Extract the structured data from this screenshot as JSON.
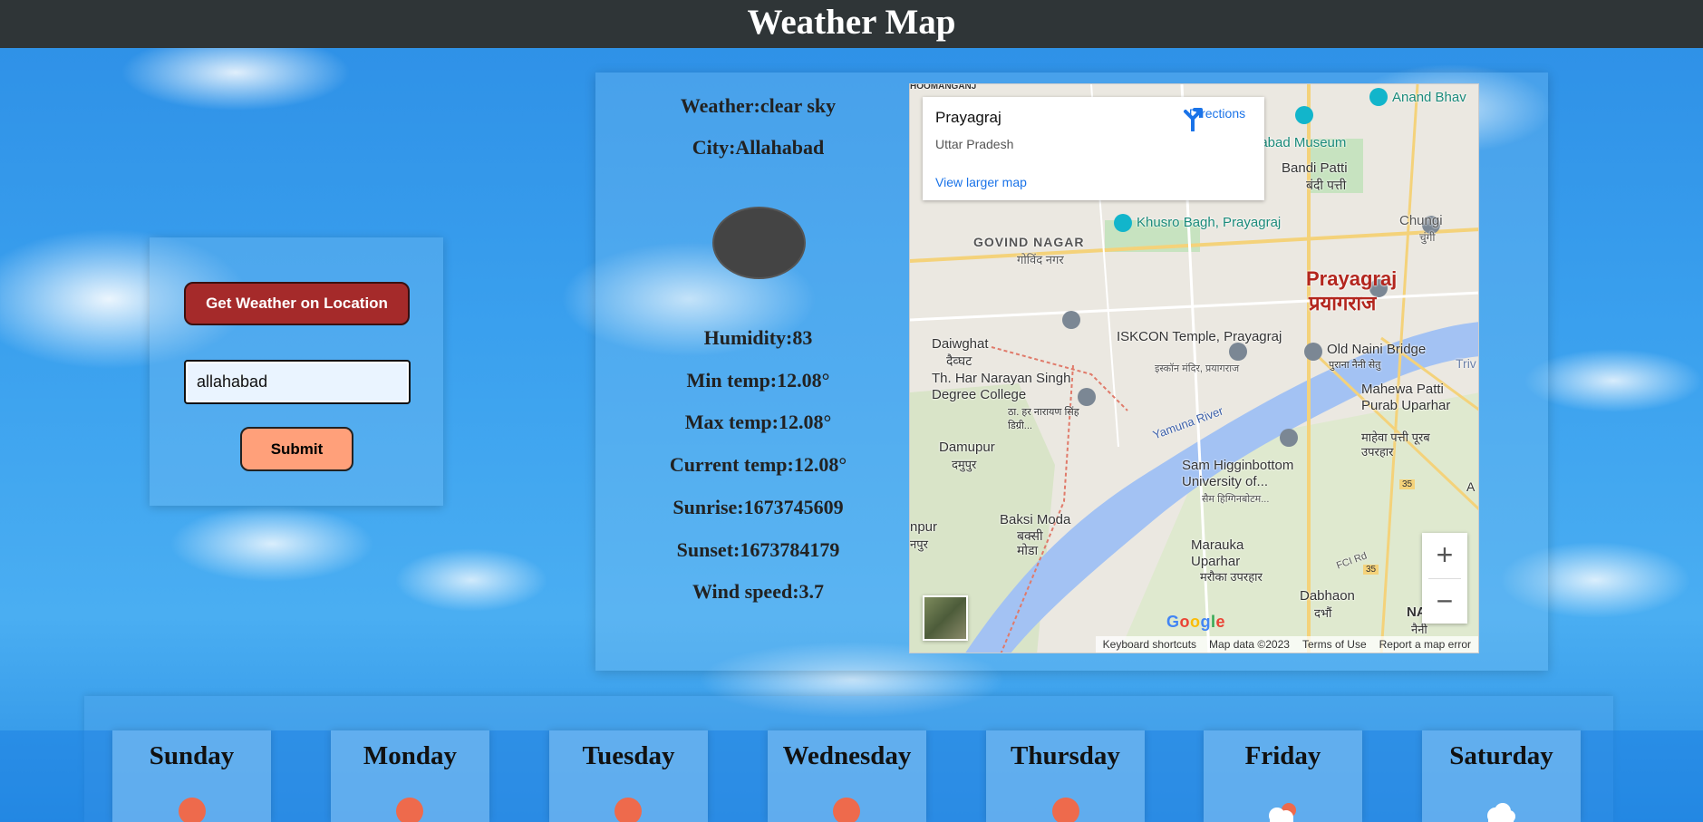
{
  "header": {
    "title": "Weather Map"
  },
  "controls": {
    "geo_button_label": "Get Weather on Location",
    "city_value": "allahabad",
    "submit_label": "Submit"
  },
  "weather": {
    "condition": "Weather:clear sky",
    "city": "City:Allahabad",
    "icon": "weather-icon",
    "humidity": "Humidity:83",
    "min_temp": "Min temp:12.08°",
    "max_temp": "Max temp:12.08°",
    "current_temp": "Current temp:12.08°",
    "sunrise": "Sunrise:1673745609",
    "sunset": "Sunset:1673784179",
    "wind_speed": "Wind speed:3.7"
  },
  "map": {
    "place_name": "Prayagraj",
    "region": "Uttar Pradesh",
    "directions_label": "Directions",
    "larger_map_label": "View larger map",
    "labels": {
      "city_en": "Prayagraj",
      "city_hi": "प्रयागराज",
      "govind_nagar": "GOVIND NAGAR",
      "govind_nagar_hi": "गोविंद नगर",
      "khusro": "Khusro Bagh, Prayagraj",
      "museum": "habad Museum",
      "anand": "Anand Bhav",
      "bandi_patti": "Bandi Patti",
      "bandi_patti_hi": "बंदी पत्ती",
      "chungi": "Chungi",
      "chungi_hi": "चुंगी",
      "daiwghat": "Daiwghat",
      "daiwghat_hi": "दैव्घट",
      "iskcon": "ISKCON Temple, Prayagraj",
      "iskcon_hi": "इस्कॉन मंदिर, प्रयागराज",
      "old_naini": "Old Naini Bridge",
      "old_naini_hi": "पुराना नैनी सेतु",
      "college": "Th. Har Narayan Singh Degree College",
      "college_hi": "ठा. हर नारायण सिंह डिग्री...",
      "yamuna": "Yamuna River",
      "mahewa": "Mahewa Patti Purab Uparhar",
      "mahewa_hi": "माहेवा पत्ती पूरब उपरहार",
      "damupur": "Damupur",
      "damupur_hi": "दमुपुर",
      "shuats": "Sam Higginbottom University of...",
      "shuats_hi": "सैम हिग्गिनबोटम...",
      "baksi": "Baksi Moda",
      "baksi_hi": "बक्सी मोडा",
      "marauka": "Marauka Uparhar",
      "marauka_hi": "मरौका उपरहार",
      "dabhaon": "Dabhaon",
      "dabhaon_hi": "दभौं",
      "naini": "NAIN",
      "naini_hi": "नैनी",
      "road_35": "35",
      "fci_rd": "FCI Rd",
      "trive": "Triv",
      "a_label": "A",
      "hoomangans": "HOOMANGANJ",
      "npur": "npur",
      "npur_hi": "नपुर"
    },
    "google_logo": "Google",
    "attribution": {
      "shortcuts": "Keyboard shortcuts",
      "data": "Map data ©2023",
      "terms": "Terms of Use",
      "report": "Report a map error"
    }
  },
  "forecast": {
    "days": [
      {
        "name": "Sunday",
        "icon": "sun-icon"
      },
      {
        "name": "Monday",
        "icon": "sun-icon"
      },
      {
        "name": "Tuesday",
        "icon": "sun-icon"
      },
      {
        "name": "Wednesday",
        "icon": "sun-icon"
      },
      {
        "name": "Thursday",
        "icon": "sun-icon"
      },
      {
        "name": "Friday",
        "icon": "cloud-sun-icon"
      },
      {
        "name": "Saturday",
        "icon": "cloud-icon"
      }
    ]
  },
  "colors": {
    "topbar": "#2f3537",
    "geo_button": "#a52a2a",
    "submit_button": "#ffa07a",
    "sun": "#ee6a4c"
  }
}
